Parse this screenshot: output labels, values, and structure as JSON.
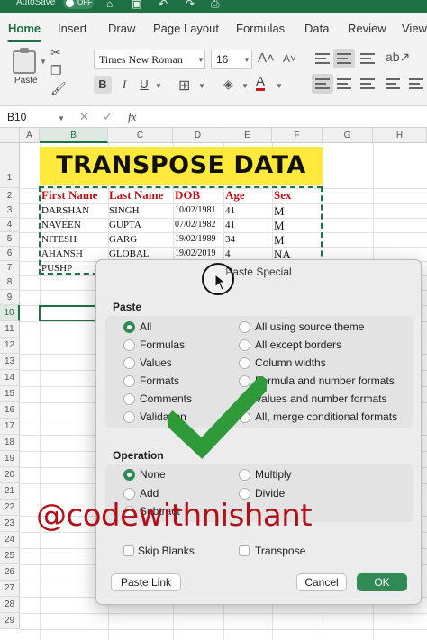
{
  "titlebar": {
    "autosave_label": "AutoSave",
    "toggle_state": "OFF"
  },
  "ribbon": {
    "tabs": [
      "Home",
      "Insert",
      "Draw",
      "Page Layout",
      "Formulas",
      "Data",
      "Review",
      "View"
    ],
    "active_tab": "Home",
    "paste_label": "Paste",
    "font_name": "Times New Roman",
    "font_size": "16",
    "bold": "B",
    "italic": "I",
    "underline": "U"
  },
  "formula_bar": {
    "name_box": "B10",
    "cancel": "✕",
    "confirm": "✓",
    "fx": "fx",
    "value": ""
  },
  "sheet": {
    "columns": [
      "A",
      "B",
      "C",
      "D",
      "E",
      "F",
      "G",
      "H"
    ],
    "rows": [
      "1",
      "2",
      "3",
      "4",
      "5",
      "6",
      "7",
      "8",
      "9",
      "10",
      "11",
      "12",
      "13",
      "14",
      "15",
      "16",
      "17",
      "18",
      "19",
      "20",
      "21",
      "22",
      "23",
      "24",
      "25",
      "26",
      "27",
      "28",
      "29"
    ],
    "selected_cell": "B10",
    "banner": "TRANSPOSE DATA",
    "table_headers": [
      "First Name",
      "Last Name",
      "DOB",
      "Age",
      "Sex"
    ],
    "table_rows": [
      [
        "DARSHAN",
        "SINGH",
        "10/02/1981",
        "41",
        "M"
      ],
      [
        "NAVEEN",
        "GUPTA",
        "07/02/1982",
        "41",
        "M"
      ],
      [
        "NITESH",
        "GARG",
        "19/02/1989",
        "34",
        "M"
      ],
      [
        "AHANSH",
        "GLOBAL",
        "19/02/2019",
        "4",
        "NA"
      ],
      [
        "PUSHP",
        "",
        "",
        "",
        ""
      ]
    ]
  },
  "dialog": {
    "title": "Paste Special",
    "paste_section": "Paste",
    "paste_left": [
      "All",
      "Formulas",
      "Values",
      "Formats",
      "Comments",
      "Validation"
    ],
    "paste_right": [
      "All using source theme",
      "All except borders",
      "Column widths",
      "Formula and number formats",
      "Values and number formats",
      "All, merge conditional formats"
    ],
    "paste_selected": "All",
    "operation_section": "Operation",
    "operation_left": [
      "None",
      "Add",
      "Subtract"
    ],
    "operation_right": [
      "Multiply",
      "Divide"
    ],
    "operation_selected": "None",
    "skip_blanks": "Skip Blanks",
    "transpose": "Transpose",
    "paste_link": "Paste Link",
    "cancel": "Cancel",
    "ok": "OK"
  },
  "overlay": {
    "watermark": "@codewithnishant"
  },
  "colors": {
    "accent": "#1e7145",
    "banner_bg": "#ffe93a",
    "header_text": "#c0101a",
    "watermark": "#b30f18",
    "check": "#2f9a3a",
    "ok_button": "#2f8a55"
  }
}
